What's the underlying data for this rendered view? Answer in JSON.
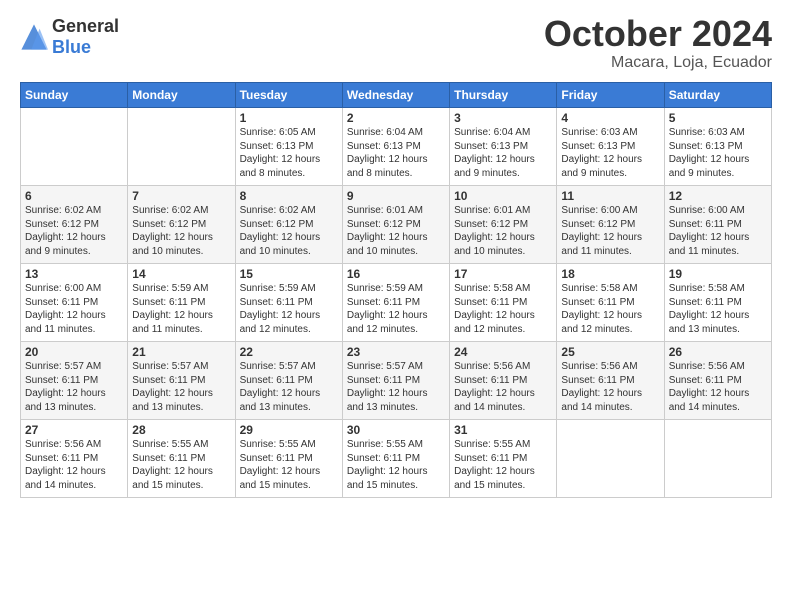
{
  "header": {
    "logo_general": "General",
    "logo_blue": "Blue",
    "month_year": "October 2024",
    "location": "Macara, Loja, Ecuador"
  },
  "weekdays": [
    "Sunday",
    "Monday",
    "Tuesday",
    "Wednesday",
    "Thursday",
    "Friday",
    "Saturday"
  ],
  "weeks": [
    [
      {
        "day": "",
        "info": ""
      },
      {
        "day": "",
        "info": ""
      },
      {
        "day": "1",
        "info": "Sunrise: 6:05 AM\nSunset: 6:13 PM\nDaylight: 12 hours and 8 minutes."
      },
      {
        "day": "2",
        "info": "Sunrise: 6:04 AM\nSunset: 6:13 PM\nDaylight: 12 hours and 8 minutes."
      },
      {
        "day": "3",
        "info": "Sunrise: 6:04 AM\nSunset: 6:13 PM\nDaylight: 12 hours and 9 minutes."
      },
      {
        "day": "4",
        "info": "Sunrise: 6:03 AM\nSunset: 6:13 PM\nDaylight: 12 hours and 9 minutes."
      },
      {
        "day": "5",
        "info": "Sunrise: 6:03 AM\nSunset: 6:13 PM\nDaylight: 12 hours and 9 minutes."
      }
    ],
    [
      {
        "day": "6",
        "info": "Sunrise: 6:02 AM\nSunset: 6:12 PM\nDaylight: 12 hours and 9 minutes."
      },
      {
        "day": "7",
        "info": "Sunrise: 6:02 AM\nSunset: 6:12 PM\nDaylight: 12 hours and 10 minutes."
      },
      {
        "day": "8",
        "info": "Sunrise: 6:02 AM\nSunset: 6:12 PM\nDaylight: 12 hours and 10 minutes."
      },
      {
        "day": "9",
        "info": "Sunrise: 6:01 AM\nSunset: 6:12 PM\nDaylight: 12 hours and 10 minutes."
      },
      {
        "day": "10",
        "info": "Sunrise: 6:01 AM\nSunset: 6:12 PM\nDaylight: 12 hours and 10 minutes."
      },
      {
        "day": "11",
        "info": "Sunrise: 6:00 AM\nSunset: 6:12 PM\nDaylight: 12 hours and 11 minutes."
      },
      {
        "day": "12",
        "info": "Sunrise: 6:00 AM\nSunset: 6:11 PM\nDaylight: 12 hours and 11 minutes."
      }
    ],
    [
      {
        "day": "13",
        "info": "Sunrise: 6:00 AM\nSunset: 6:11 PM\nDaylight: 12 hours and 11 minutes."
      },
      {
        "day": "14",
        "info": "Sunrise: 5:59 AM\nSunset: 6:11 PM\nDaylight: 12 hours and 11 minutes."
      },
      {
        "day": "15",
        "info": "Sunrise: 5:59 AM\nSunset: 6:11 PM\nDaylight: 12 hours and 12 minutes."
      },
      {
        "day": "16",
        "info": "Sunrise: 5:59 AM\nSunset: 6:11 PM\nDaylight: 12 hours and 12 minutes."
      },
      {
        "day": "17",
        "info": "Sunrise: 5:58 AM\nSunset: 6:11 PM\nDaylight: 12 hours and 12 minutes."
      },
      {
        "day": "18",
        "info": "Sunrise: 5:58 AM\nSunset: 6:11 PM\nDaylight: 12 hours and 12 minutes."
      },
      {
        "day": "19",
        "info": "Sunrise: 5:58 AM\nSunset: 6:11 PM\nDaylight: 12 hours and 13 minutes."
      }
    ],
    [
      {
        "day": "20",
        "info": "Sunrise: 5:57 AM\nSunset: 6:11 PM\nDaylight: 12 hours and 13 minutes."
      },
      {
        "day": "21",
        "info": "Sunrise: 5:57 AM\nSunset: 6:11 PM\nDaylight: 12 hours and 13 minutes."
      },
      {
        "day": "22",
        "info": "Sunrise: 5:57 AM\nSunset: 6:11 PM\nDaylight: 12 hours and 13 minutes."
      },
      {
        "day": "23",
        "info": "Sunrise: 5:57 AM\nSunset: 6:11 PM\nDaylight: 12 hours and 13 minutes."
      },
      {
        "day": "24",
        "info": "Sunrise: 5:56 AM\nSunset: 6:11 PM\nDaylight: 12 hours and 14 minutes."
      },
      {
        "day": "25",
        "info": "Sunrise: 5:56 AM\nSunset: 6:11 PM\nDaylight: 12 hours and 14 minutes."
      },
      {
        "day": "26",
        "info": "Sunrise: 5:56 AM\nSunset: 6:11 PM\nDaylight: 12 hours and 14 minutes."
      }
    ],
    [
      {
        "day": "27",
        "info": "Sunrise: 5:56 AM\nSunset: 6:11 PM\nDaylight: 12 hours and 14 minutes."
      },
      {
        "day": "28",
        "info": "Sunrise: 5:55 AM\nSunset: 6:11 PM\nDaylight: 12 hours and 15 minutes."
      },
      {
        "day": "29",
        "info": "Sunrise: 5:55 AM\nSunset: 6:11 PM\nDaylight: 12 hours and 15 minutes."
      },
      {
        "day": "30",
        "info": "Sunrise: 5:55 AM\nSunset: 6:11 PM\nDaylight: 12 hours and 15 minutes."
      },
      {
        "day": "31",
        "info": "Sunrise: 5:55 AM\nSunset: 6:11 PM\nDaylight: 12 hours and 15 minutes."
      },
      {
        "day": "",
        "info": ""
      },
      {
        "day": "",
        "info": ""
      }
    ]
  ]
}
